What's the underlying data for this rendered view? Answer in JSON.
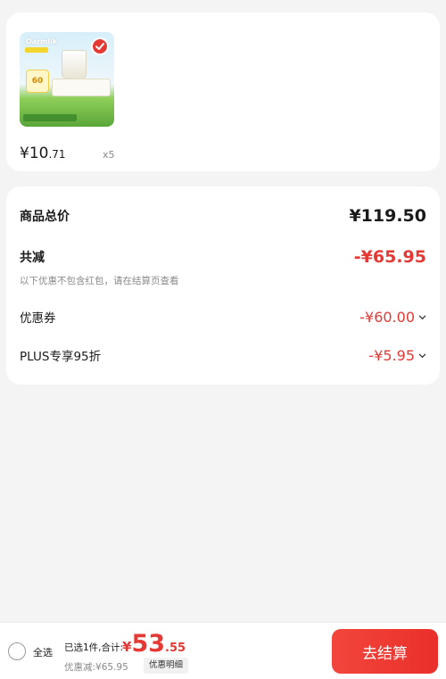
{
  "product": {
    "image_brand_text": "Oarmilk",
    "image_badge_text": "60",
    "price_int": "¥10",
    "price_dec": ".71",
    "quantity": "x5"
  },
  "summary": {
    "goods_total_label": "商品总价",
    "goods_total_value": "¥119.50",
    "total_discount_label": "共减",
    "total_discount_value": "-¥65.95",
    "note": "以下优惠不包含红包，请在结算页查看",
    "coupon_label": "优惠券",
    "coupon_value": "-¥60.00",
    "plus_label": "PLUS专享95折",
    "plus_value": "-¥5.95"
  },
  "bottom_bar": {
    "select_all": "全选",
    "selected_info": "已选1件,合计:",
    "total_symbol": "¥",
    "total_int": "53",
    "total_dec": ".55",
    "saved": "优惠减:¥65.95",
    "detail_button": "优惠明细",
    "checkout_button": "去结算"
  },
  "colors": {
    "accent_red": "#e53935",
    "background": "#f4f4f4"
  }
}
